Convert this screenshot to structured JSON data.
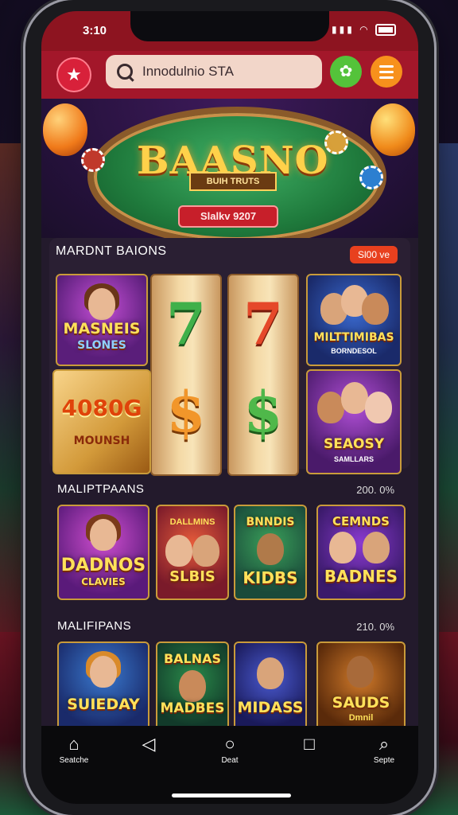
{
  "status_bar": {
    "time": "3:10"
  },
  "top_bar": {
    "search_placeholder": "Innodulnio STA"
  },
  "hero": {
    "title": "BAASNO",
    "subtitle": "BUIH TRUTS",
    "badge": "Slalkv  9207"
  },
  "featured": {
    "title": "MARDNT BAIONS",
    "pill": "Sl00 ve",
    "tiles": [
      {
        "title": "MASNEIS",
        "sub": "SLONES"
      },
      {
        "title": "MILTTIMIBAS",
        "sub": "BORNDESOL"
      },
      {
        "title": "4080G",
        "sub": "MOUNSH"
      },
      {
        "title": "SEAOSY",
        "sub": "SAMLLARS"
      }
    ],
    "reels": [
      "7",
      "7",
      "$",
      "$"
    ]
  },
  "row1": {
    "title": "MALIPTPAANS",
    "value": "200. 0%",
    "tiles": [
      {
        "title": "DADNOS",
        "sub": "CLAVIES"
      },
      {
        "title": "SLBIS",
        "sub": "DALLMINS"
      },
      {
        "title": "KIDBS",
        "sub": "BNNDIS"
      },
      {
        "title": "BADNES",
        "sub": "CEMNDS"
      }
    ]
  },
  "row2": {
    "title": "MALIFIPANS",
    "value": "210. 0%",
    "tiles": [
      {
        "title": "SUIEDAY",
        "sub": ""
      },
      {
        "title": "MADBES",
        "sub": "BALNAS"
      },
      {
        "title": "MIDASS",
        "sub": ""
      },
      {
        "title": "SAUDS",
        "sub": "Dmnil"
      }
    ]
  },
  "nav": [
    {
      "label": "Seatche",
      "icon": "home-icon"
    },
    {
      "label": "",
      "icon": "back-icon"
    },
    {
      "label": "Deat",
      "icon": "circle-home-icon"
    },
    {
      "label": "",
      "icon": "square-recents-icon"
    },
    {
      "label": "Septe",
      "icon": "search-icon"
    }
  ]
}
